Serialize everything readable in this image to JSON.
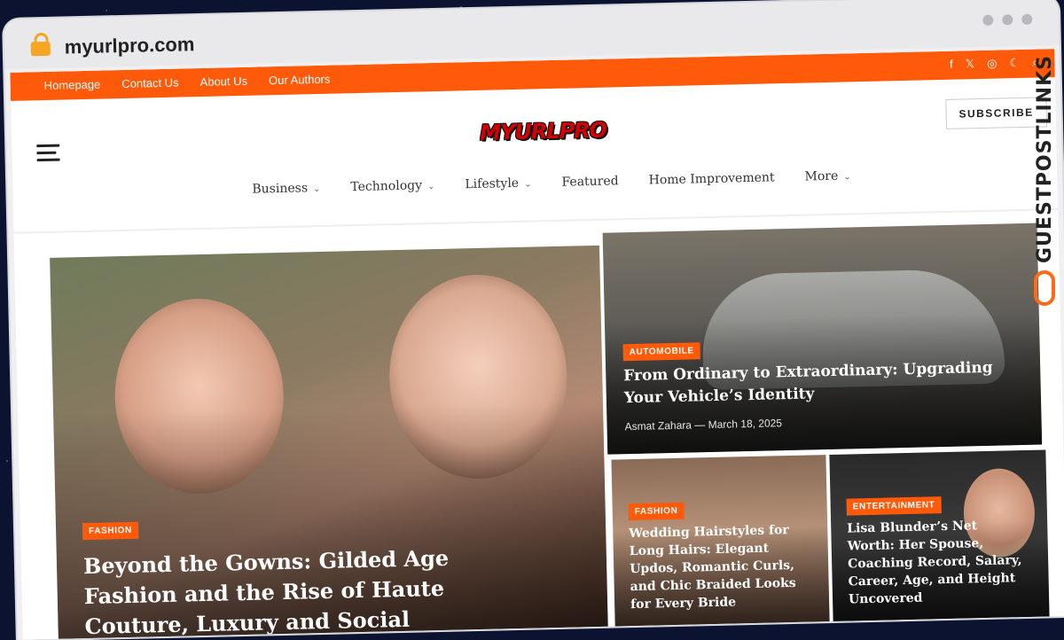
{
  "browser": {
    "url": "myurlpro.com"
  },
  "topbar": {
    "nav": [
      "Homepage",
      "Contact Us",
      "About Us",
      "Our Authors"
    ],
    "icons": [
      "facebook-icon",
      "x-icon",
      "instagram-icon",
      "moon-icon",
      "search-icon"
    ]
  },
  "header": {
    "logo_text": "MYURLPRO",
    "subscribe_label": "SUBSCRIBE"
  },
  "mainnav": {
    "items": [
      {
        "label": "Business",
        "dropdown": true
      },
      {
        "label": "Technology",
        "dropdown": true
      },
      {
        "label": "Lifestyle",
        "dropdown": true
      },
      {
        "label": "Featured",
        "dropdown": false
      },
      {
        "label": "Home Improvement",
        "dropdown": false
      },
      {
        "label": "More",
        "dropdown": true
      }
    ]
  },
  "articles": {
    "hero": {
      "category": "FASHION",
      "title": "Beyond the Gowns: Gilded Age Fashion and the Rise of Haute Couture, Luxury and Social Expectations"
    },
    "car": {
      "category": "AUTOMOBILE",
      "title": "From Ordinary to Extraordinary: Upgrading Your Vehicle’s Identity",
      "author": "Asmat Zahara",
      "date": "March 18, 2025"
    },
    "hair": {
      "category": "FASHION",
      "title": "Wedding Hairstyles for Long Hairs: Elegant Updos, Romantic Curls, and Chic Braided Looks for Every Bride"
    },
    "ent": {
      "category": "ENTERTAINMENT",
      "title": "Lisa Blunder’s Net Worth: Her Spouse, Coaching Record, Salary, Career, Age, and Height Uncovered"
    }
  },
  "watermark": {
    "text": "GUESTPOSTLINKS"
  },
  "colors": {
    "accent": "#ff5a0a"
  }
}
